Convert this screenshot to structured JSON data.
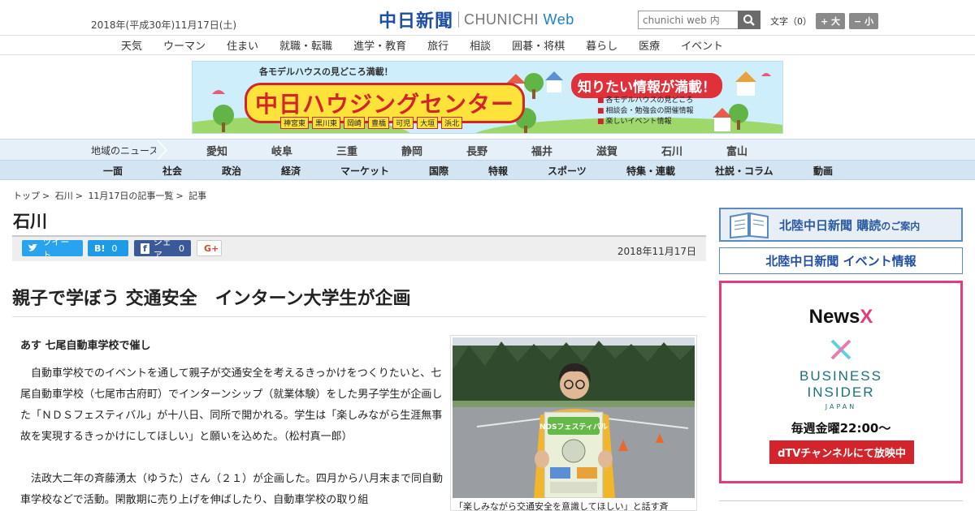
{
  "header": {
    "date": "2018年(平成30年)11月17日(土)",
    "logo_jp": "中日新聞",
    "logo_en": "CHUNICHI",
    "logo_web": "Web",
    "search_placeholder": "chunichi web 内",
    "fontsize_label": "文字（0）",
    "fontsize_larger": "+ 大",
    "fontsize_smaller": "− 小"
  },
  "category_nav": [
    "天気",
    "ウーマン",
    "住まい",
    "就職・転職",
    "進学・教育",
    "旅行",
    "相談",
    "囲碁・将棋",
    "暮らし",
    "医療",
    "イベント"
  ],
  "banner": {
    "top_text": "各モデルハウスの見どころ満載！",
    "title": "中日ハウジングセンター",
    "right_title": "知りたい情報が満載！",
    "list": [
      "各モデルハウスの見どころ",
      "相談会・勉強会の開催情報",
      "楽しいイベント情報"
    ],
    "cities": [
      "神宮東",
      "黒川東",
      "岡崎",
      "豊橋",
      "可児",
      "大垣",
      "浜北"
    ]
  },
  "regional_nav": {
    "label": "地域のニュース",
    "items": [
      "愛知",
      "岐阜",
      "三重",
      "静岡",
      "長野",
      "福井",
      "滋賀",
      "石川",
      "富山"
    ]
  },
  "section_nav": [
    "一面",
    "社会",
    "政治",
    "経済",
    "マーケット",
    "国際",
    "特報",
    "スポーツ",
    "特集・連載",
    "社説・コラム",
    "動画"
  ],
  "breadcrumb": [
    "トップ",
    "石川",
    "11月17日の記事一覧",
    "記事"
  ],
  "section_title": "石川",
  "share": {
    "tweet": "ツイート",
    "hatena": "B!",
    "hatena_count": "0",
    "facebook": "シェア",
    "facebook_count": "0",
    "gplus": "G+"
  },
  "pub_date": "2018年11月17日",
  "article": {
    "headline": "親子で学ぼう 交通安全　インターン大学生が企画",
    "subhead": "あす 七尾自動車学校で催し",
    "paragraphs": [
      "自動車学校でのイベントを通して親子が交通安全を考えるきっかけをつくりたいと、七尾自動車学校（七尾市古府町）でインターンシップ（就業体験）をした男子学生が企画した「ＮＤＳフェスティバル」が十八日、同所で開かれる。学生は「楽しみながら生涯無事故を実現するきっかけにしてほしい」と願いを込めた。（松村真一郎）",
      "法政大二年の斉藤湧太（ゆうた）さん（２１）が企画した。四月から八月末まで同自動車学校などで活動。閑散期に売り上げを伸ばしたり、自動車学校の取り組"
    ],
    "photo_caption": "「楽しみながら交通安全を意識してほしい」と話す斉",
    "photo_sign": "NDSフェスティバル"
  },
  "sidebar": {
    "ad1": "北陸中日新聞 購読",
    "ad1_small": "のご案内",
    "ad2": "北陸中日新聞 イベント情報",
    "newsx": "News",
    "newsx_x": "X",
    "bi_line1": "BUSINESS",
    "bi_line2": "INSIDER",
    "bi_jp": "JAPAN",
    "weekly": "毎週金曜22:00〜",
    "dtv": "dTVチャンネルにて放映中"
  },
  "colors": {
    "brand_blue": "#1f4fa3",
    "nav_light": "#e6f0f8",
    "nav_section": "#d3e4f2",
    "ad_border": "#e23c7a",
    "dtv_red": "#d2242a"
  }
}
